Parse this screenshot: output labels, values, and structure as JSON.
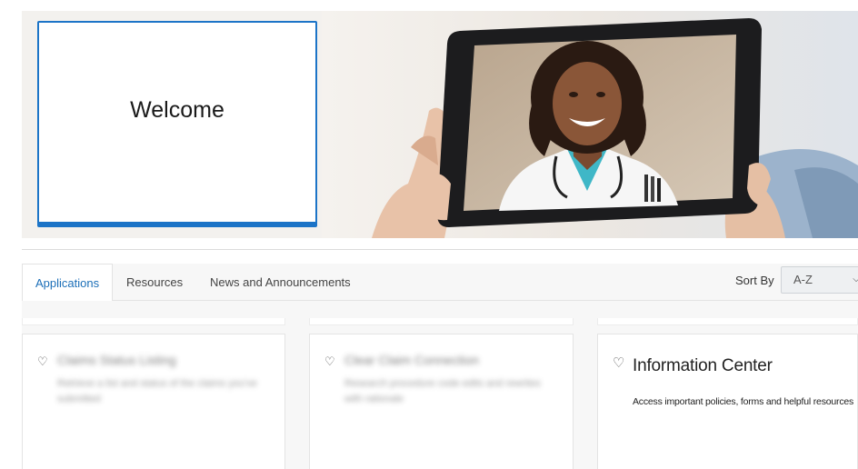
{
  "hero": {
    "welcome_title": "Welcome"
  },
  "tabs": [
    {
      "label": "Applications",
      "active": true
    },
    {
      "label": "Resources",
      "active": false
    },
    {
      "label": "News and Announcements",
      "active": false
    }
  ],
  "sort": {
    "label": "Sort By",
    "selected": "A-Z"
  },
  "cards": [
    {
      "title": "Claims Status Listing",
      "description": "Retrieve a list and status of the claims you've submitted",
      "blurred": true
    },
    {
      "title": "Clear Claim Connection",
      "description": "Research procedure code edits and rewrites with rationale",
      "blurred": true
    },
    {
      "title": "Information Center",
      "description": "Access important policies, forms and helpful resources",
      "blurred": false
    }
  ],
  "colors": {
    "accent": "#1c74c7",
    "tab_active_text": "#1c6fb8"
  }
}
